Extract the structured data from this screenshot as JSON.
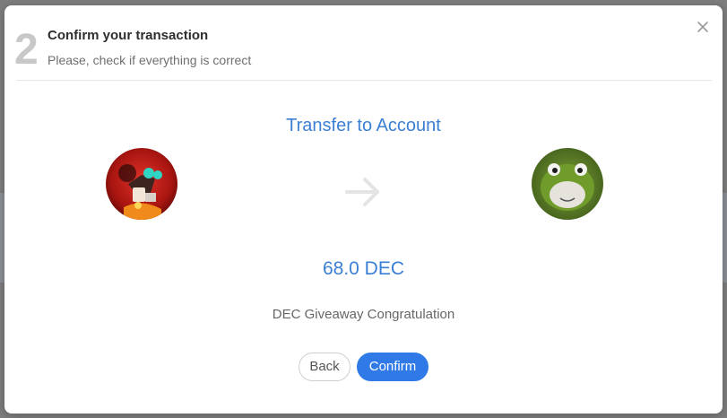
{
  "dialog": {
    "step_number": "2",
    "title": "Confirm your transaction",
    "subtitle": "Please, check if everything is correct",
    "close_icon": "close-icon"
  },
  "transfer": {
    "heading": "Transfer to Account",
    "arrow_icon": "arrow-right-icon",
    "sender_avatar": "sender-avatar",
    "recipient_avatar": "recipient-avatar",
    "amount": "68.0 DEC",
    "memo": "DEC Giveaway Congratulation"
  },
  "actions": {
    "back_label": "Back",
    "confirm_label": "Confirm"
  },
  "colors": {
    "accent": "#3b7fd4",
    "confirm_button": "#2f7ae6",
    "step_number": "#c8c8c8"
  }
}
